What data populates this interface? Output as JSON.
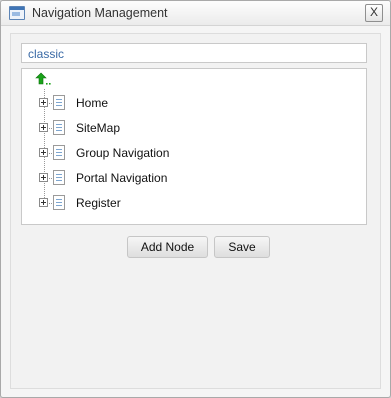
{
  "window": {
    "title": "Navigation Management",
    "close_label": "X"
  },
  "site": {
    "name": "classic"
  },
  "tree": {
    "nodes": [
      {
        "label": "Home"
      },
      {
        "label": "SiteMap"
      },
      {
        "label": "Group Navigation"
      },
      {
        "label": "Portal Navigation"
      },
      {
        "label": "Register"
      }
    ]
  },
  "actions": {
    "add_node_label": "Add Node",
    "save_label": "Save"
  },
  "colors": {
    "accent_text": "#3a6aa6",
    "up_arrow": "#1aa31a"
  },
  "icons": [
    "window-icon",
    "close-icon",
    "up-level-icon",
    "expand-icon",
    "page-icon"
  ]
}
